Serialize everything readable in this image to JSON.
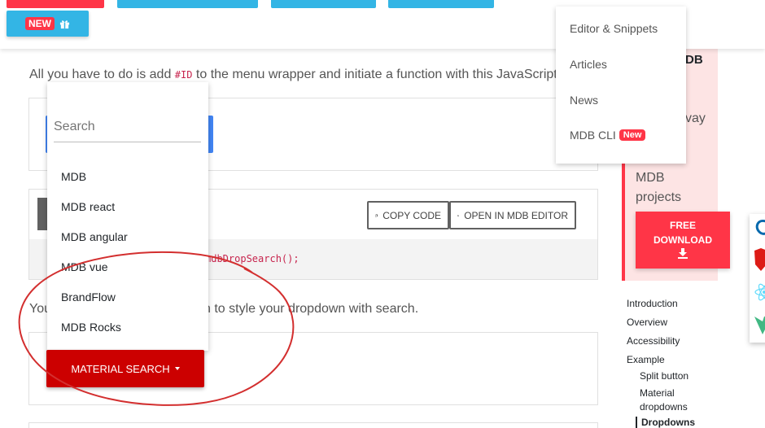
{
  "topbar": {
    "new_badge": "NEW"
  },
  "intro": {
    "before": "All you have to do is add ",
    "code": "#ID",
    "after": " to the menu wrapper and initiate a function with this JavaScript c"
  },
  "code_snippet": "mdbDropSearch();",
  "code_buttons": {
    "copy": "COPY CODE",
    "open_editor": "OPEN IN MDB EDITOR"
  },
  "intro2": {
    "start": "You",
    "end": "n to style your dropdown with search."
  },
  "search_menu": {
    "placeholder": "Search",
    "items": [
      "MDB",
      "MDB react",
      "MDB angular",
      "MDB vue",
      "BrandFlow",
      "MDB Rocks"
    ]
  },
  "material_search_button": "MATERIAL SEARCH",
  "nav_dropdown": {
    "items": [
      "Editor & Snippets",
      "Articles",
      "News",
      "MDB CLI"
    ],
    "new_badge": "New"
  },
  "sidebar_card": {
    "title_fragment": "DB",
    "text_fragment": "vay",
    "projects_text": "MDB projects",
    "download_line1": "FREE",
    "download_line2": "DOWNLOAD"
  },
  "toc": {
    "items": [
      "Introduction",
      "Overview",
      "Accessibility",
      "Example"
    ],
    "subitems": [
      "Split button",
      "Material dropdowns",
      "Dropdowns"
    ]
  },
  "colors": {
    "accent_red": "#ff3547",
    "material_button": "#cc0000",
    "topbar_blue": "#33b5e5",
    "primary_blue": "#4285f4",
    "annotation_circle": "#d32f2f"
  }
}
